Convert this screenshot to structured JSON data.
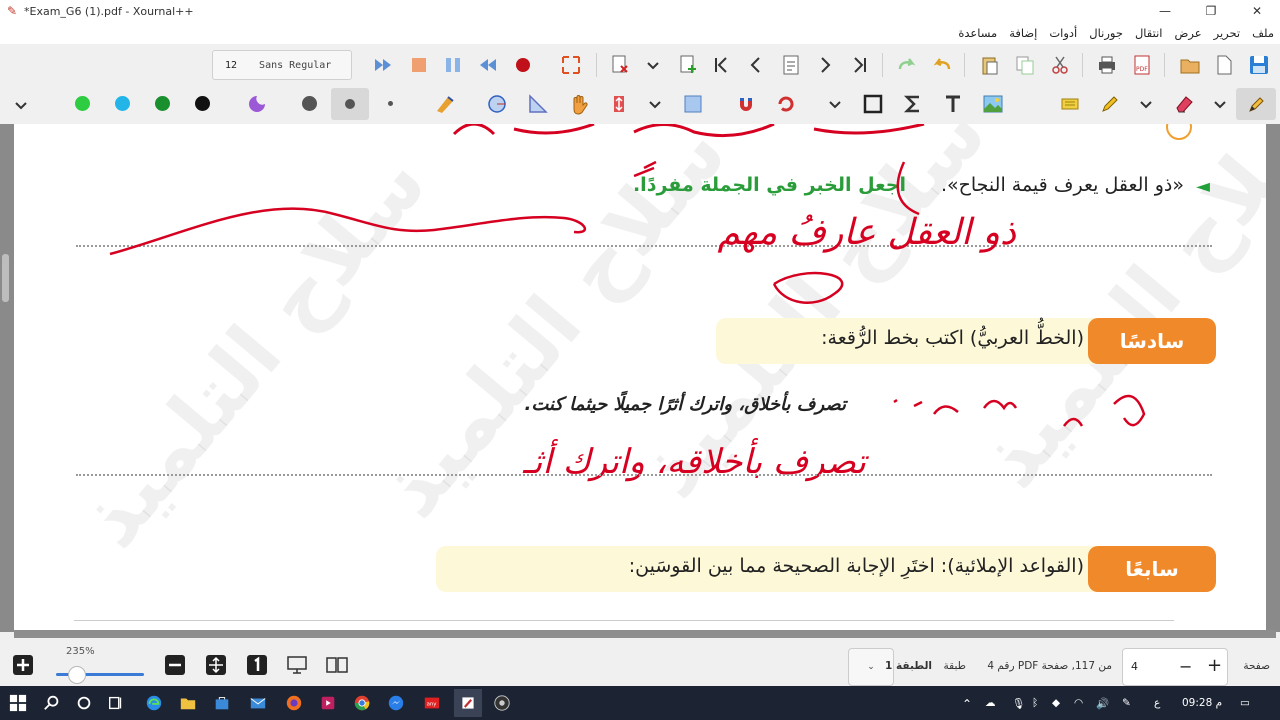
{
  "window": {
    "title": "*Exam_G6 (1).pdf - Xournal++"
  },
  "menubar": {
    "items": [
      "ملف",
      "تحرير",
      "عرض",
      "انتقال",
      "جورنال",
      "أدوات",
      "إضافة",
      "مساعدة"
    ]
  },
  "toolbar": {
    "font_size": "12",
    "font_face": "Sans Regular"
  },
  "colors": {
    "green": "#2ecc40",
    "cyan": "#23b5e8",
    "dark_green": "#1a8f2e",
    "black": "#111111",
    "purple": "#9b59d6",
    "ink_red": "#d60021",
    "accent_orange": "#f0892a"
  },
  "document": {
    "q_prefix": "◄",
    "q_sentence": "«ذو العقل يعرف قيمة النجاح».",
    "q_instruction": "اجعل الخبر في الجملة مفردًا.",
    "handwritten_answer_1": "ذو العقل عارفُ مهم",
    "section6_tab": "سادسًا",
    "section6_text": "(الخطُّ العربيُّ) اكتب بخط الرُّقعة:",
    "ruqaa_sentence": "تصرف بأخلاق، واترك أثرًا جميلًا حيثما كنت.",
    "handwritten_answer_2": "تصرف بأخلاقه، واترك أثـ",
    "section7_tab": "سابعًا",
    "section7_text": "(القواعد الإملائية): اختَرِ الإجابة الصحيحة مما بين القوسَين:",
    "watermark": "سلاح التلميذ"
  },
  "statusbar": {
    "zoom": "235%",
    "layer_label": "طبقة",
    "layer_value": "الطبقة 1",
    "page_info": "من 117, صفحة PDF رقم 4",
    "page_value": "4",
    "page_label": "صفحة"
  },
  "taskbar": {
    "time": "09:28 م",
    "lang": "ع"
  }
}
